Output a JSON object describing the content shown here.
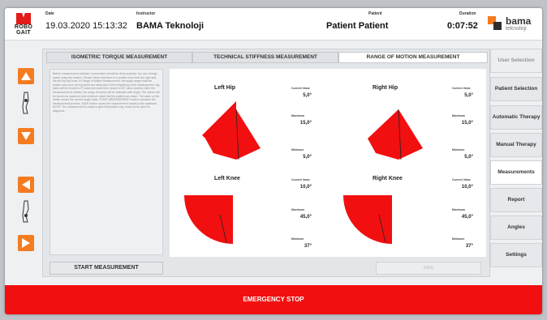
{
  "header": {
    "logo_text": "ROBO\nGAIT",
    "date_label": "Date",
    "date_value": "19.03.2020  15:13:32",
    "instructor_label": "Instructor",
    "instructor_value": "BAMA Teknoloji",
    "patient_label": "Patient",
    "patient_value": "Patient Patient",
    "duration_label": "Duration",
    "duration_value": "0:07:52",
    "brand_name": "bama",
    "brand_sub": "teknoloji"
  },
  "tabs": [
    {
      "label": "ISOMETRIC TORQUE MEASUREMENT",
      "active": false
    },
    {
      "label": "TECHNICAL STIFFNESS MEASUREMENT",
      "active": false
    },
    {
      "label": "RANGE OF MOTION MEASUREMENT",
      "active": true
    }
  ],
  "description": "Before measurement software, a procedure should be done properly. You can change speed using the buttons. Please check that there is a position from both the right and the left hip and knee. In Range of Motion Measurement, the angle ranges that the patient can move the leg joints are measured. At the beginning of the measurement, leg joints will be moved to 0° value point and then moved to 30° value position. After the measurement is started, the range of motion will be indicated with angle. The values will be shown as maximum and minimum value that the patient can reach. The value on the center shows the current angle value. START MEASUREMENT button: activates the measurement process. SAVE button: saves the measurement results to the database. NOTE: The measurement is made to give information only, must not be used for diagnosis.",
  "buttons": {
    "start": "START MEASUREMENT",
    "save": "SAVE",
    "emergency": "EMERGENCY STOP"
  },
  "stat_labels": {
    "current": "Current Value",
    "maximum": "Maximum",
    "minimum": "Minimum"
  },
  "joints": [
    {
      "id": "left-hip",
      "title": "Left Hip",
      "current": "5,0°",
      "maximum": "15,0°",
      "minimum": "5,0°"
    },
    {
      "id": "right-hip",
      "title": "Right Hip",
      "current": "5,0°",
      "maximum": "15,0°",
      "minimum": "5,0°"
    },
    {
      "id": "left-knee",
      "title": "Left Knee",
      "current": "10,0°",
      "maximum": "45,0°",
      "minimum": "37°"
    },
    {
      "id": "right-knee",
      "title": "Right Knee",
      "current": "10,0°",
      "maximum": "45,0°",
      "minimum": "37°"
    }
  ],
  "menu": [
    {
      "label": "User Selection",
      "state": "disabled"
    },
    {
      "label": "Patient Selection",
      "state": "normal"
    },
    {
      "label": "Automatic Therapy",
      "state": "normal"
    },
    {
      "label": "Manual Therapy",
      "state": "normal"
    },
    {
      "label": "Measurements",
      "state": "active"
    },
    {
      "label": "Report",
      "state": "normal"
    },
    {
      "label": "Angles",
      "state": "normal"
    },
    {
      "label": "Settings",
      "state": "normal"
    }
  ],
  "icons": {
    "up": "arrow-up-icon",
    "down": "arrow-down-icon",
    "left": "arrow-left-icon",
    "right": "arrow-right-icon",
    "leg": "leg-icon"
  },
  "colors": {
    "accent": "#f47b20",
    "emergency": "#f20f10",
    "sector": "#f20f10",
    "brand_red": "#e21b1b"
  }
}
